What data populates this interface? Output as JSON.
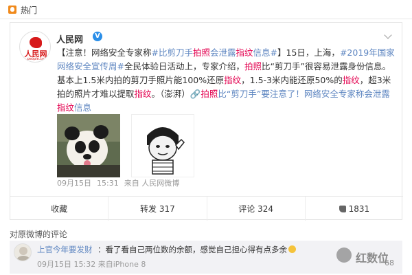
{
  "topbar": {
    "label": "热门",
    "icon": "fire-icon"
  },
  "post": {
    "author": "人民网",
    "verified_mark": "V",
    "avatar_logo_text": "人民网",
    "avatar_logo_sub": "people.cn",
    "text_segments": {
      "s1": "【注意！网络安全专家称",
      "s2": "#比剪刀手",
      "s3": "拍照",
      "s4": "会泄露",
      "s5": "指纹",
      "s6": "信息#",
      "s7": "】15日，上海，",
      "s8": "#2019年国家网络安全宣传周#",
      "s9": "全民体验日活动上，专家介绍，",
      "s10": "拍照",
      "s11": "比“剪刀手”很容易泄露身份信息。基本上1.5米内拍的剪刀手照片能100%还原",
      "s12": "指纹",
      "s13": "，1.5-3米内能还原50%的",
      "s14": "指纹",
      "s15": "，超3米拍的照片才难以提取",
      "s16": "指纹",
      "s17": "。（澎湃）",
      "s18": "🔗",
      "s19": "拍照",
      "s20": "比“剪刀手”要注意了！网络安全专家称会泄露",
      "s21": "指纹",
      "s22": "信息"
    },
    "meta": {
      "date": "09月15日",
      "time": "15:31",
      "source": "来自 人民网微博"
    },
    "actions": {
      "favorite": "收藏",
      "repost": "转发 317",
      "comment": "评论 324",
      "like": "1831"
    }
  },
  "comments": {
    "header": "对原微博的评论",
    "items": [
      {
        "user": "上官今年要发财",
        "text": "：看了看自己两位数的余额，感觉自己担心得有点多余",
        "date": "09月15日",
        "time": "15:32",
        "source": "来自iPhone 8",
        "likes": "68"
      }
    ]
  },
  "watermark": {
    "text": "红数位"
  },
  "colors": {
    "link": "#5e86c1",
    "highlight": "#e3004f",
    "brand": "#d71a1b",
    "hot": "#f08a1c"
  }
}
